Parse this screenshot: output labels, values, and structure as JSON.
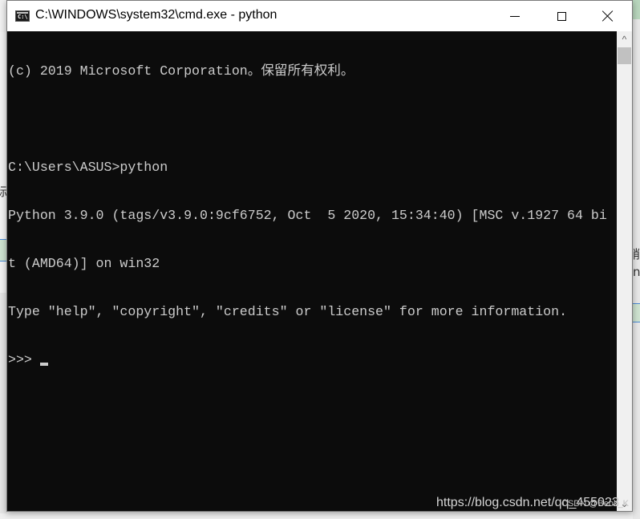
{
  "window": {
    "title": "C:\\WINDOWS\\system32\\cmd.exe - python",
    "icon_label": "C:\\",
    "icon": "console-icon",
    "controls": {
      "minimize": "minimize-icon",
      "maximize": "maximize-icon",
      "close": "close-icon"
    }
  },
  "console": {
    "lines": [
      "(c) 2019 Microsoft Corporation。保留所有权利。",
      "",
      "C:\\Users\\ASUS>python",
      "Python 3.9.0 (tags/v3.9.0:9cf6752, Oct  5 2020, 15:34:40) [MSC v.1927 64 bi",
      "t (AMD64)] on win32",
      "Type \"help\", \"copyright\", \"credits\" or \"license\" for more information."
    ],
    "prompt": ">>> "
  },
  "scrollbar": {
    "up_arrow": "^",
    "down_arrow": "⌄"
  },
  "watermark": {
    "url": "https://blog.csdn.net/qq_455023",
    "credit": "CSDN @Beok_K"
  },
  "background": {
    "left_fragment_1": "标",
    "right_fragment_1": "削",
    "right_fragment_2": "ne"
  }
}
